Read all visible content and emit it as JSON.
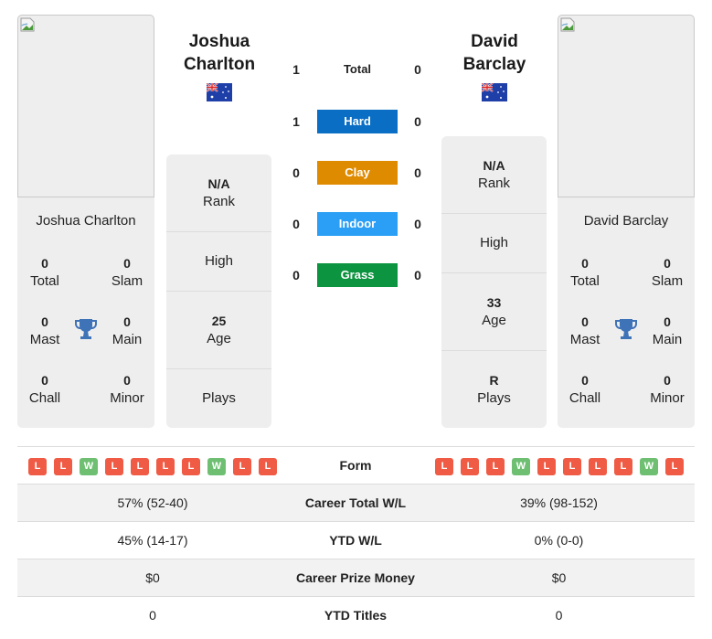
{
  "colors": {
    "hard": "#0a6ec4",
    "clay": "#de8b00",
    "indoor": "#2b9ff5",
    "grass": "#0d9440",
    "loss": "#ef5b44",
    "win": "#6fbf73",
    "trophy": "#3f73b8"
  },
  "player1": {
    "name": "Joshua Charlton",
    "name_line1": "Joshua",
    "name_line2": "Charlton",
    "country_flag": "australia-flag-icon",
    "photo_alt": "broken-image-icon",
    "titles": {
      "total": {
        "value": "0",
        "label": "Total"
      },
      "slam": {
        "value": "0",
        "label": "Slam"
      },
      "mast": {
        "value": "0",
        "label": "Mast"
      },
      "main": {
        "value": "0",
        "label": "Main"
      },
      "chall": {
        "value": "0",
        "label": "Chall"
      },
      "minor": {
        "value": "0",
        "label": "Minor"
      }
    },
    "info": {
      "rank": {
        "value": "N/A",
        "label": "Rank"
      },
      "high": {
        "value": "",
        "label": "High"
      },
      "age": {
        "value": "25",
        "label": "Age"
      },
      "plays": {
        "value": "",
        "label": "Plays"
      }
    },
    "form": [
      "L",
      "L",
      "W",
      "L",
      "L",
      "L",
      "L",
      "W",
      "L",
      "L"
    ]
  },
  "player2": {
    "name": "David Barclay",
    "name_line1": "David",
    "name_line2": "Barclay",
    "country_flag": "australia-flag-icon",
    "photo_alt": "broken-image-icon",
    "titles": {
      "total": {
        "value": "0",
        "label": "Total"
      },
      "slam": {
        "value": "0",
        "label": "Slam"
      },
      "mast": {
        "value": "0",
        "label": "Mast"
      },
      "main": {
        "value": "0",
        "label": "Main"
      },
      "chall": {
        "value": "0",
        "label": "Chall"
      },
      "minor": {
        "value": "0",
        "label": "Minor"
      }
    },
    "info": {
      "rank": {
        "value": "N/A",
        "label": "Rank"
      },
      "high": {
        "value": "",
        "label": "High"
      },
      "age": {
        "value": "33",
        "label": "Age"
      },
      "plays": {
        "value": "R",
        "label": "Plays"
      }
    },
    "form": [
      "L",
      "L",
      "L",
      "W",
      "L",
      "L",
      "L",
      "L",
      "W",
      "L"
    ]
  },
  "h2h": [
    {
      "label": "Total",
      "p1": "1",
      "p2": "0",
      "type": "total"
    },
    {
      "label": "Hard",
      "p1": "1",
      "p2": "0",
      "type": "hard"
    },
    {
      "label": "Clay",
      "p1": "0",
      "p2": "0",
      "type": "clay"
    },
    {
      "label": "Indoor",
      "p1": "0",
      "p2": "0",
      "type": "indoor"
    },
    {
      "label": "Grass",
      "p1": "0",
      "p2": "0",
      "type": "grass"
    }
  ],
  "stats": {
    "form_label": "Form",
    "rows": [
      {
        "label": "Career Total W/L",
        "p1": "57% (52-40)",
        "p2": "39% (98-152)"
      },
      {
        "label": "YTD W/L",
        "p1": "45% (14-17)",
        "p2": "0% (0-0)"
      },
      {
        "label": "Career Prize Money",
        "p1": "$0",
        "p2": "$0"
      },
      {
        "label": "YTD Titles",
        "p1": "0",
        "p2": "0"
      }
    ]
  }
}
